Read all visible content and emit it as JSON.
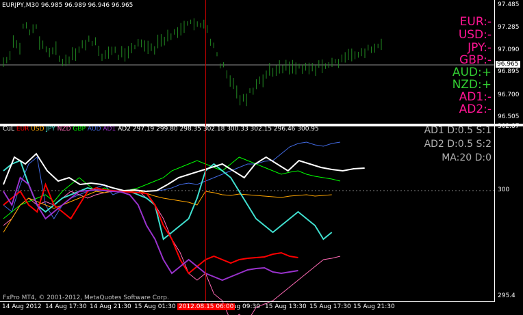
{
  "chart_header": "EURJPY,M30  96.985 96.989 96.946 96.965",
  "price_axis": [
    "97.485",
    "97.285",
    "97.090",
    "96.895",
    "96.700",
    "96.505"
  ],
  "current_price": "96.965",
  "indicator_axis": [
    "302.87",
    "300",
    "295.4"
  ],
  "indicator_header": {
    "prefix": "CuL",
    "items": [
      {
        "name": "EUR",
        "color": "#ff0000"
      },
      {
        "name": "USD",
        "color": "#ffa500"
      },
      {
        "name": "JPY",
        "color": "#40e0d0"
      },
      {
        "name": "NZD",
        "color": "#ff69b4"
      },
      {
        "name": "GBP",
        "color": "#00ff00"
      },
      {
        "name": "AUD",
        "color": "#4169e1"
      },
      {
        "name": "AD1",
        "color": "#9932cc"
      },
      {
        "name": "AD2",
        "color": "#ffffff"
      }
    ],
    "values": "297.19 299.80 298.35 302.18 300.33 302.15 296.46 300.95"
  },
  "signals": [
    {
      "text": "EUR:-",
      "color": "#ff1493"
    },
    {
      "text": "USD:-",
      "color": "#ff1493"
    },
    {
      "text": "JPY:-",
      "color": "#ff1493"
    },
    {
      "text": "GBP:-",
      "color": "#ff1493"
    },
    {
      "text": "AUD:+",
      "color": "#32cd32"
    },
    {
      "text": "NZD:+",
      "color": "#32cd32"
    },
    {
      "text": "AD1:-",
      "color": "#ff1493"
    },
    {
      "text": "AD2:-",
      "color": "#ff1493"
    }
  ],
  "info": [
    "AD1 D:0.5 S:1",
    "AD2 D:0.5 S:2",
    "MA:20 D:0"
  ],
  "copyright": "FxPro MT4, © 2001-2012, MetaQuotes Software Corp.",
  "time_axis": [
    "14 Aug 2012",
    "14 Aug 17:30",
    "14 Aug 21:30",
    "15 Aug 01:30",
    "",
    "0 Aug 09:30",
    "15 Aug 13:30",
    "15 Aug 17:30",
    "15 Aug 21:30"
  ],
  "selected_time": "2012.08.15 06:00",
  "colors": {
    "bars": "#228b22",
    "crosshair": "#c00000"
  }
}
